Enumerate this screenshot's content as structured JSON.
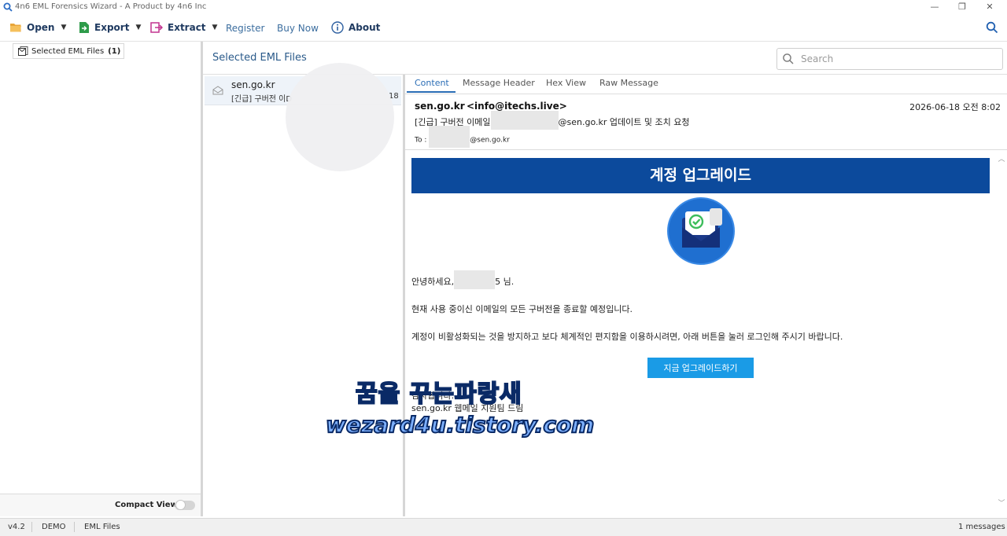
{
  "window": {
    "title": "4n6 EML Forensics Wizard - A Product by 4n6 Inc",
    "controls": {
      "minimize": "—",
      "restore": "❐",
      "close": "✕"
    }
  },
  "toolbar": {
    "open_label": "Open",
    "export_label": "Export",
    "extract_label": "Extract",
    "register_label": "Register",
    "buynow_label": "Buy Now",
    "about_label": "About"
  },
  "left_panel": {
    "tree_item_label": "Selected EML Files",
    "tree_item_count": "(1)",
    "compact_view_label": "Compact View",
    "compact_view_on": false
  },
  "list_header": {
    "title": "Selected EML Files"
  },
  "search": {
    "placeholder": "Search",
    "value": ""
  },
  "mail_list": [
    {
      "from": "sen.go.kr",
      "subject": "[긴급] 구버전 이D",
      "date_fragment": "18"
    }
  ],
  "preview": {
    "tabs": [
      "Content",
      "Message Header",
      "Hex View",
      "Raw Message"
    ],
    "active_tab": "Content",
    "from_name": "sen.go.kr",
    "from_addr": "<info@itechs.live>",
    "date": "2026-06-18 오전 8:02",
    "subject_prefix": "[긴급] 구버전 이메일",
    "subject_suffix": "@sen.go.kr 업데이트 및 조치 요청",
    "to_label": "To :",
    "to_suffix": "@sen.go.kr",
    "body": {
      "banner": "계정 업그레이드",
      "greeting_prefix": "안녕하세요,",
      "greeting_suffix": "5 님.",
      "line1": "현재 사용 중이신 이메일의 모든 구버전을 종료할 예정입니다.",
      "line2": "계정이 비활성화되는 것을 방지하고 보다 체계적인 편지함을 이용하시려면, 아래 버튼을 눌러 로그인해 주시기 바랍니다.",
      "button": "지금 업그레이드하기",
      "closing1": "감사합니다.",
      "closing2": "sen.go.kr 웹메일 지원팀 드림"
    }
  },
  "watermark": {
    "line1": "꿈을 꾸는파랑새",
    "line2": "wezard4u.tistory.com"
  },
  "statusbar": {
    "version": "v4.2",
    "mode": "DEMO",
    "type": "EML Files",
    "messages": "1 messages"
  },
  "colors": {
    "accent": "#2a6db5",
    "banner": "#0c4a9c",
    "button": "#1a9be6"
  }
}
